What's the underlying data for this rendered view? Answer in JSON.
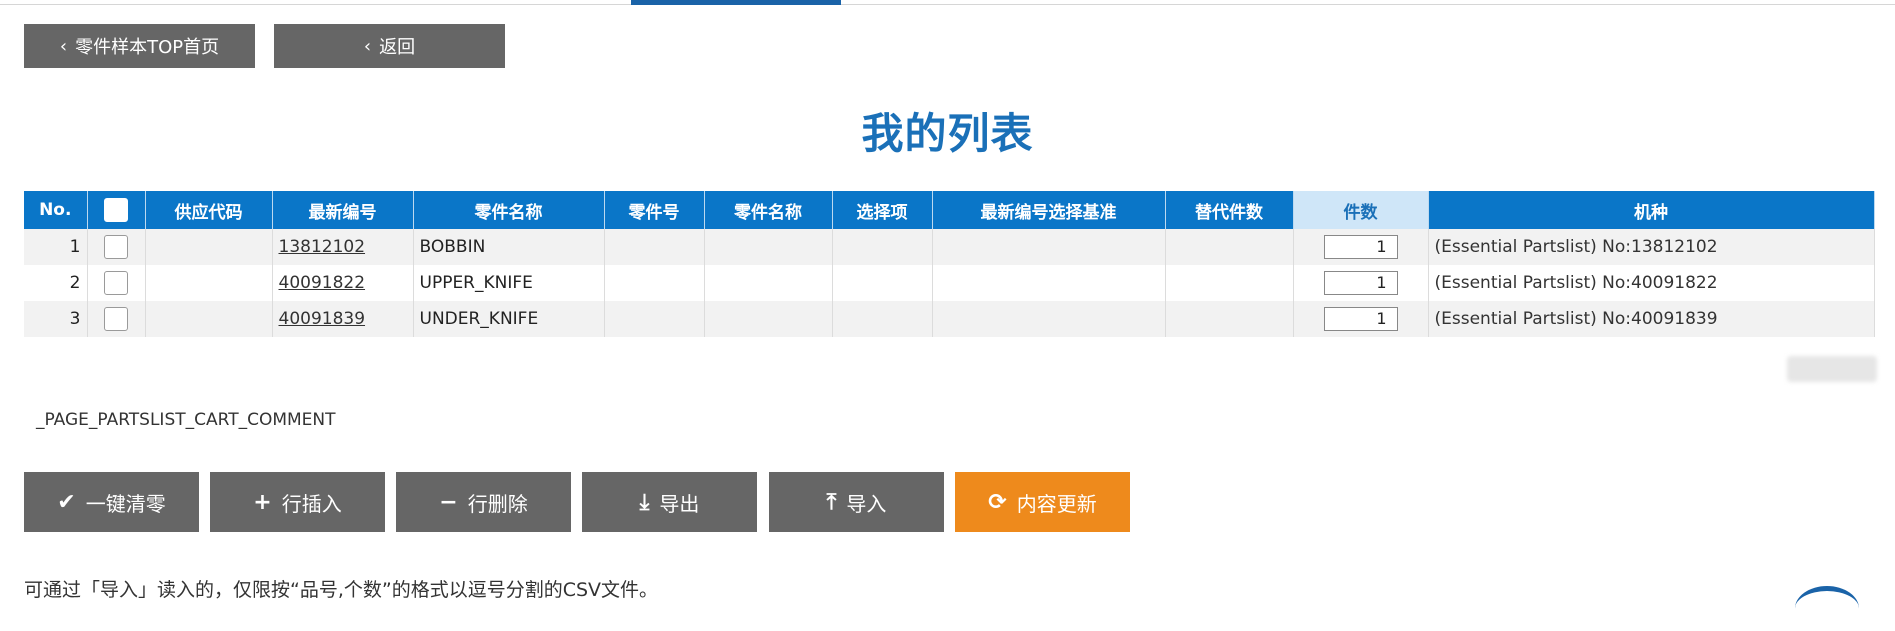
{
  "nav": {
    "top_label": "零件样本TOP首页",
    "back_label": "返回"
  },
  "page_title": "我的列表",
  "table": {
    "headers": [
      "No.",
      "",
      "供应代码",
      "最新编号",
      "零件名称",
      "零件号",
      "零件名称",
      "选择项",
      "最新编号选择基准",
      "替代件数",
      "件数",
      "机种"
    ],
    "rows": [
      {
        "no": "1",
        "supply": "",
        "latest": "13812102",
        "name": "BOBBIN",
        "part_no": "",
        "part_name": "",
        "option": "",
        "basis": "",
        "alt": "",
        "qty": "1",
        "machine": "(Essential Partslist)  No:13812102"
      },
      {
        "no": "2",
        "supply": "",
        "latest": "40091822",
        "name": "UPPER_KNIFE",
        "part_no": "",
        "part_name": "",
        "option": "",
        "basis": "",
        "alt": "",
        "qty": "1",
        "machine": "(Essential Partslist)  No:40091822"
      },
      {
        "no": "3",
        "supply": "",
        "latest": "40091839",
        "name": "UNDER_KNIFE",
        "part_no": "",
        "part_name": "",
        "option": "",
        "basis": "",
        "alt": "",
        "qty": "1",
        "machine": "(Essential Partslist)  No:40091839"
      }
    ]
  },
  "comment": "_PAGE_PARTSLIST_CART_COMMENT",
  "actions": {
    "clear": "一键清零",
    "insert": "行插入",
    "delete": "行删除",
    "export": "导出",
    "import": "导入",
    "update": "内容更新"
  },
  "note": "可通过「导入」读入的，仅限按“品号,个数”的格式以逗号分割的CSV文件。",
  "colors": {
    "header_blue": "#0a76c8",
    "title_blue": "#1a70b8",
    "button_gray": "#666666",
    "button_orange": "#ee8a1c"
  }
}
